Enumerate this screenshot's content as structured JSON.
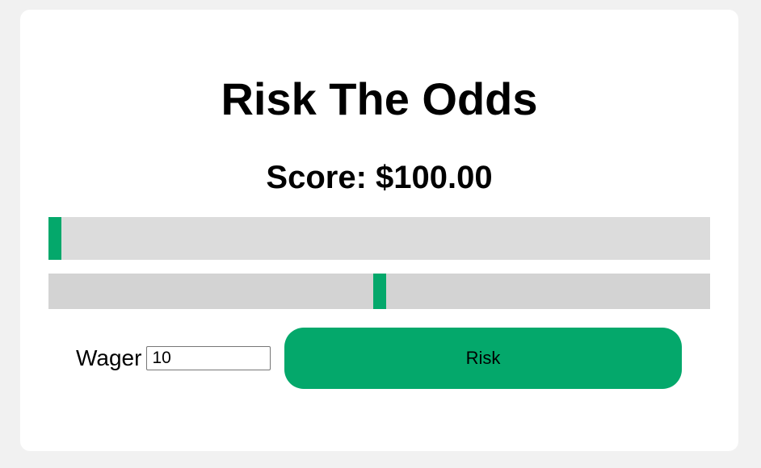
{
  "game": {
    "title": "Risk The Odds",
    "score": "Score: $100.00"
  },
  "odds_bar": {
    "position": 0.0,
    "color": "#04a86b",
    "track_color": "#dcdcdc"
  },
  "result_bar": {
    "position": 0.5,
    "color": "#04a86b",
    "track_color": "#d3d3d3"
  },
  "controls": {
    "wager_label": "Wager",
    "wager_value": "10",
    "risk_label": "Risk"
  },
  "colors": {
    "accent": "#04a86b",
    "background": "#f1f1f1",
    "card": "#ffffff"
  }
}
